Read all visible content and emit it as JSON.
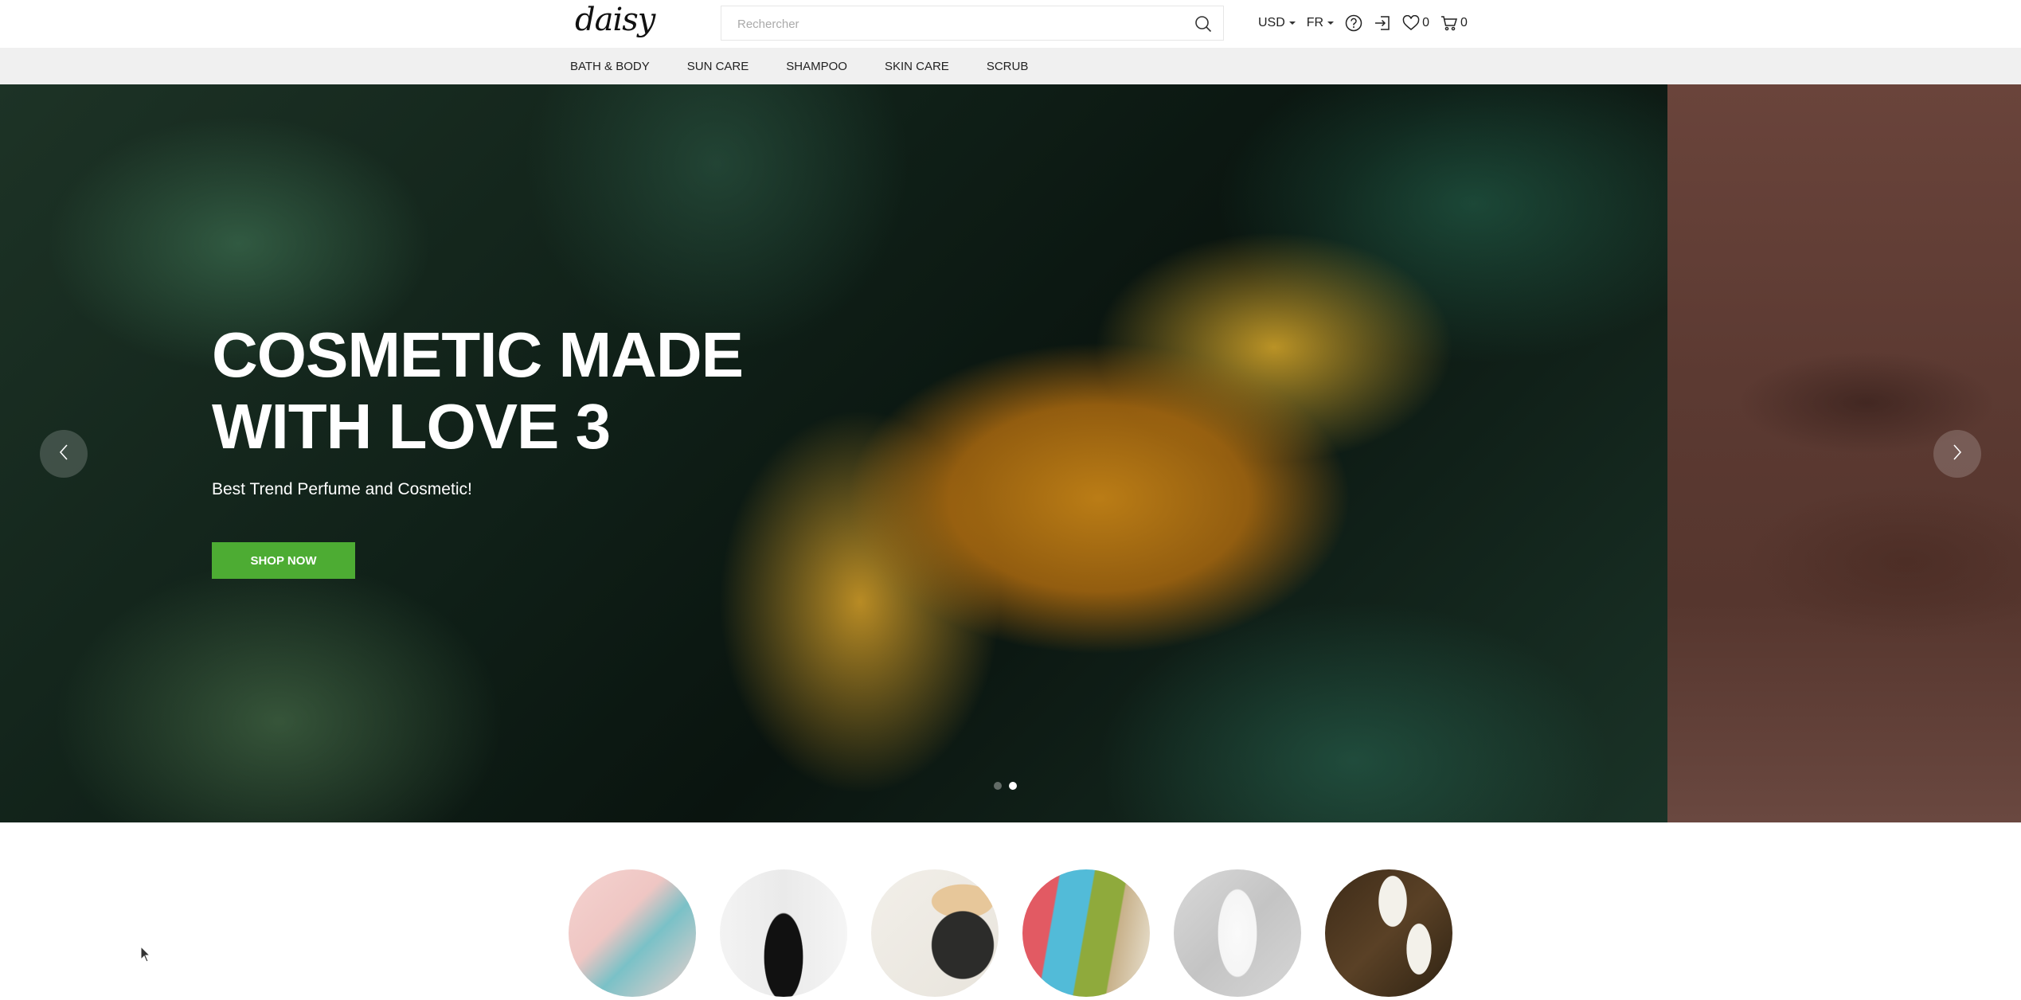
{
  "header": {
    "logo": "daisy",
    "search": {
      "placeholder": "Rechercher",
      "value": ""
    },
    "currency": "USD",
    "language": "FR",
    "wishlist_count": "0",
    "cart_count": "0",
    "icons": [
      "search-icon",
      "help-icon",
      "login-icon",
      "heart-icon",
      "cart-icon"
    ]
  },
  "nav": {
    "items": [
      {
        "label": "BATH & BODY"
      },
      {
        "label": "SUN CARE"
      },
      {
        "label": "SHAMPOO"
      },
      {
        "label": "SKIN CARE"
      },
      {
        "label": "SCRUB"
      }
    ]
  },
  "hero": {
    "title": "COSMETIC MADE WITH LOVE 3",
    "subtitle": "Best Trend Perfume and Cosmetic!",
    "cta_label": "SHOP NOW",
    "accent_color": "#4dac33",
    "slides_total": 2,
    "active_slide": 2
  },
  "categories": {
    "items": [
      {
        "name": "category-1"
      },
      {
        "name": "category-2"
      },
      {
        "name": "category-3"
      },
      {
        "name": "category-4"
      },
      {
        "name": "category-5"
      },
      {
        "name": "category-6"
      }
    ]
  }
}
